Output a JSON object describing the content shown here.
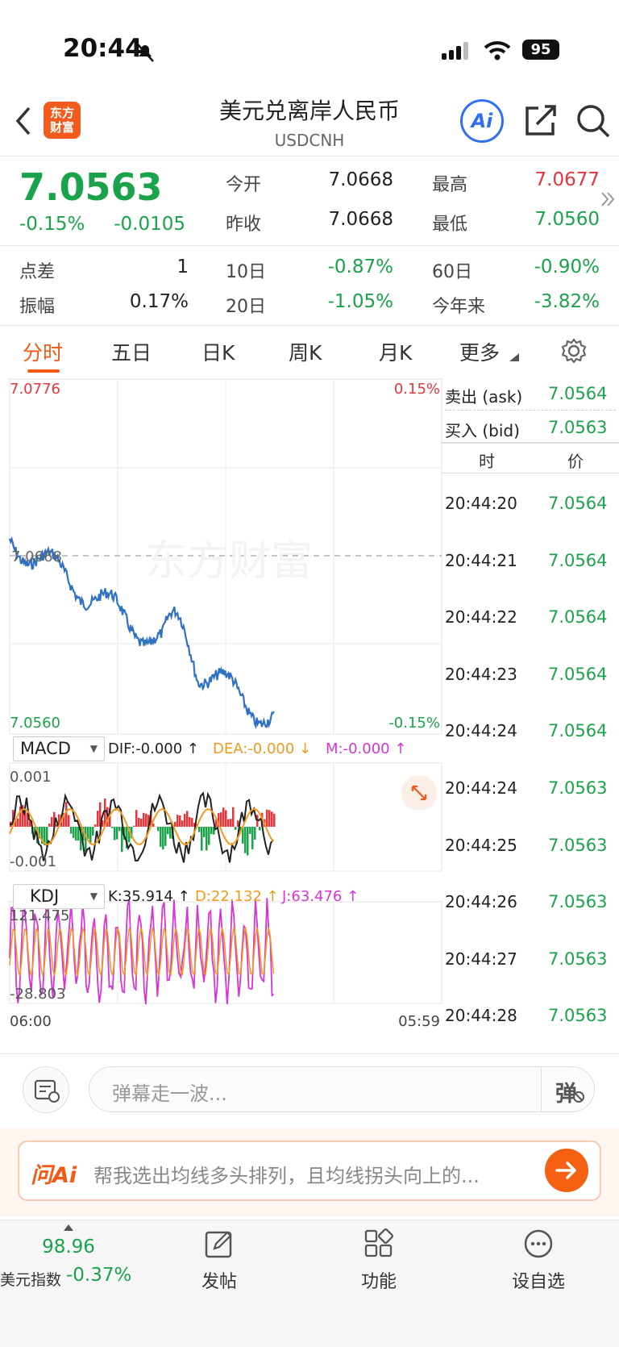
{
  "status": {
    "time": "20:44",
    "battery": "95"
  },
  "header": {
    "title": "美元兑离岸人民币",
    "subtitle": "USDCNH",
    "logo_text": "东方财富",
    "ai_label": "Ai"
  },
  "quote": {
    "price": "7.0563",
    "change_pct": "-0.15%",
    "change": "-0.0105",
    "open_label": "今开",
    "open": "7.0668",
    "high_label": "最高",
    "high": "7.0677",
    "prev_label": "昨收",
    "prev": "7.0668",
    "low_label": "最低",
    "low": "7.0560",
    "spread_label": "点差",
    "spread": "1",
    "d10_label": "10日",
    "d10": "-0.87%",
    "d60_label": "60日",
    "d60": "-0.90%",
    "amp_label": "振幅",
    "amp": "0.17%",
    "d20_label": "20日",
    "d20": "-1.05%",
    "ytd_label": "今年来",
    "ytd": "-3.82%"
  },
  "tabs": [
    "分时",
    "五日",
    "日K",
    "周K",
    "月K",
    "更多"
  ],
  "chart": {
    "top_left": "7.0776",
    "top_right": "0.15%",
    "ref_label": "7.0668",
    "bottom_left": "7.0560",
    "bottom_right": "-0.15%",
    "macd": {
      "name": "MACD",
      "dif": "DIF:-0.000 ↑",
      "dea": "DEA:-0.000 ↓",
      "m": "M:-0.000 ↑",
      "top": "0.001",
      "bottom": "-0.001"
    },
    "kdj": {
      "name": "KDJ",
      "k": "K:35.914 ↑",
      "d": "D:22.132 ↑",
      "j": "J:63.476 ↑",
      "top": "121.475",
      "bottom": "-28.803"
    },
    "x_start": "06:00",
    "x_end": "05:59",
    "watermark": "东方财富",
    "colors": {
      "line": "#2f72c4",
      "up": "#e8343a",
      "down": "#1aa34a",
      "dea": "#f39a1c",
      "j": "#d633d9"
    }
  },
  "orderbook": {
    "ask_label": "卖出 (ask)",
    "ask": "7.0564",
    "bid_label": "买入 (bid)",
    "bid": "7.0563",
    "time_header": "时",
    "price_header": "价",
    "trades": [
      {
        "time": "20:44:20",
        "price": "7.0564"
      },
      {
        "time": "20:44:21",
        "price": "7.0564"
      },
      {
        "time": "20:44:22",
        "price": "7.0564"
      },
      {
        "time": "20:44:23",
        "price": "7.0564"
      },
      {
        "time": "20:44:24",
        "price": "7.0564"
      },
      {
        "time": "20:44:24",
        "price": "7.0563"
      },
      {
        "time": "20:44:25",
        "price": "7.0563"
      },
      {
        "time": "20:44:26",
        "price": "7.0563"
      },
      {
        "time": "20:44:27",
        "price": "7.0563"
      },
      {
        "time": "20:44:28",
        "price": "7.0563"
      }
    ]
  },
  "comment": {
    "placeholder": "弹幕走一波...",
    "danmu_label": "弹"
  },
  "ask_ai": {
    "brand": "问Ai",
    "prompt": "帮我选出均线多头排列，且均线拐头向上的..."
  },
  "bottom_nav": {
    "index_value": "98.96",
    "index_name": "美元指数",
    "index_change": "-0.37%",
    "post": "发帖",
    "func": "功能",
    "watch": "设自选"
  }
}
